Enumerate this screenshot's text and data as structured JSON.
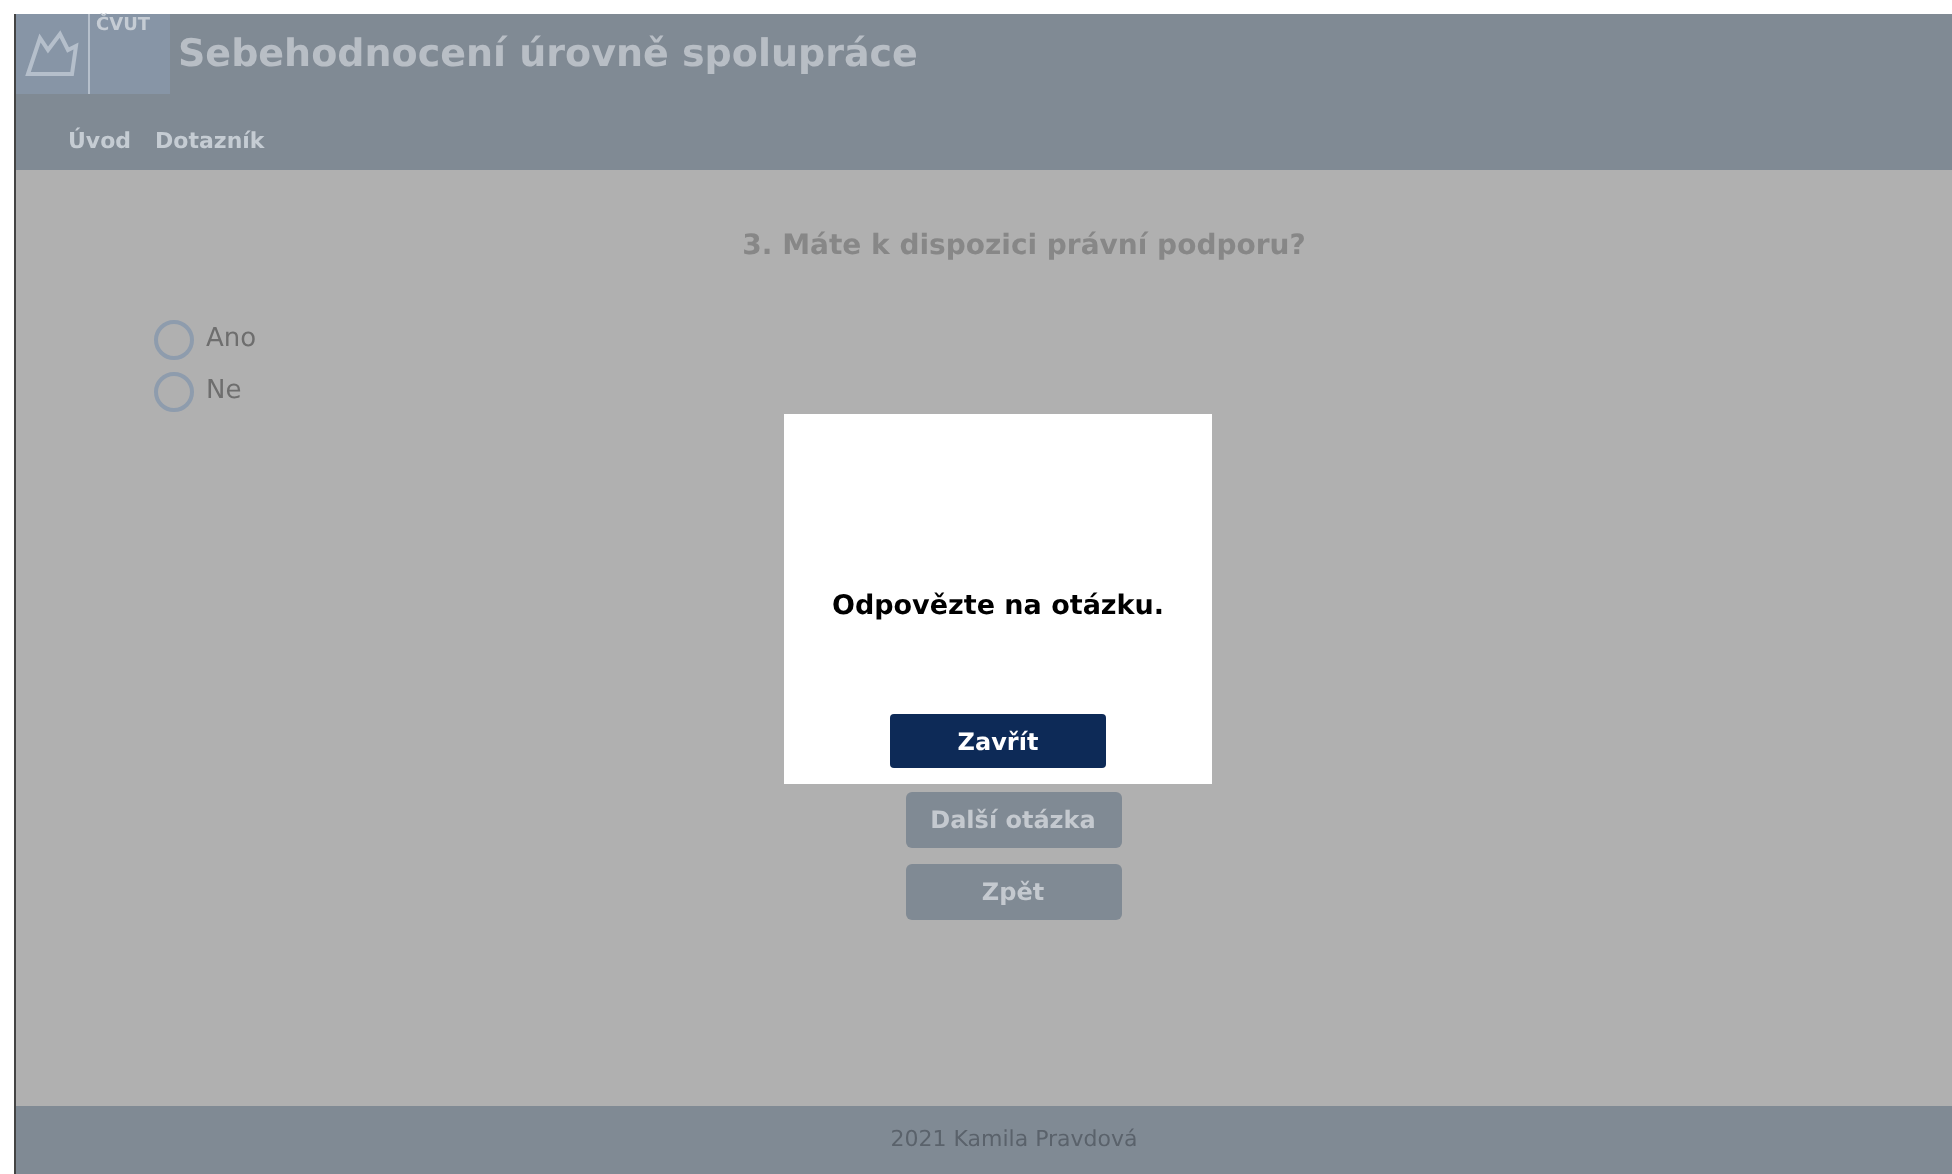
{
  "header": {
    "logo_text": "ČVUT",
    "title": "Sebehodnocení úrovně spolupráce"
  },
  "nav": [
    {
      "label": "Úvod"
    },
    {
      "label": "Dotazník"
    }
  ],
  "question": {
    "title": "3. Máte k dispozici právní podporu?",
    "options": [
      {
        "label": "Ano",
        "selected": false
      },
      {
        "label": "Ne",
        "selected": false
      }
    ]
  },
  "buttons": [
    {
      "label": "Další otázka"
    },
    {
      "label": "Zpět"
    }
  ],
  "dialog": {
    "message": "Odpovězte na otázku.",
    "button": "Zavřít"
  },
  "footer": "2021 Kamila Pravdová"
}
